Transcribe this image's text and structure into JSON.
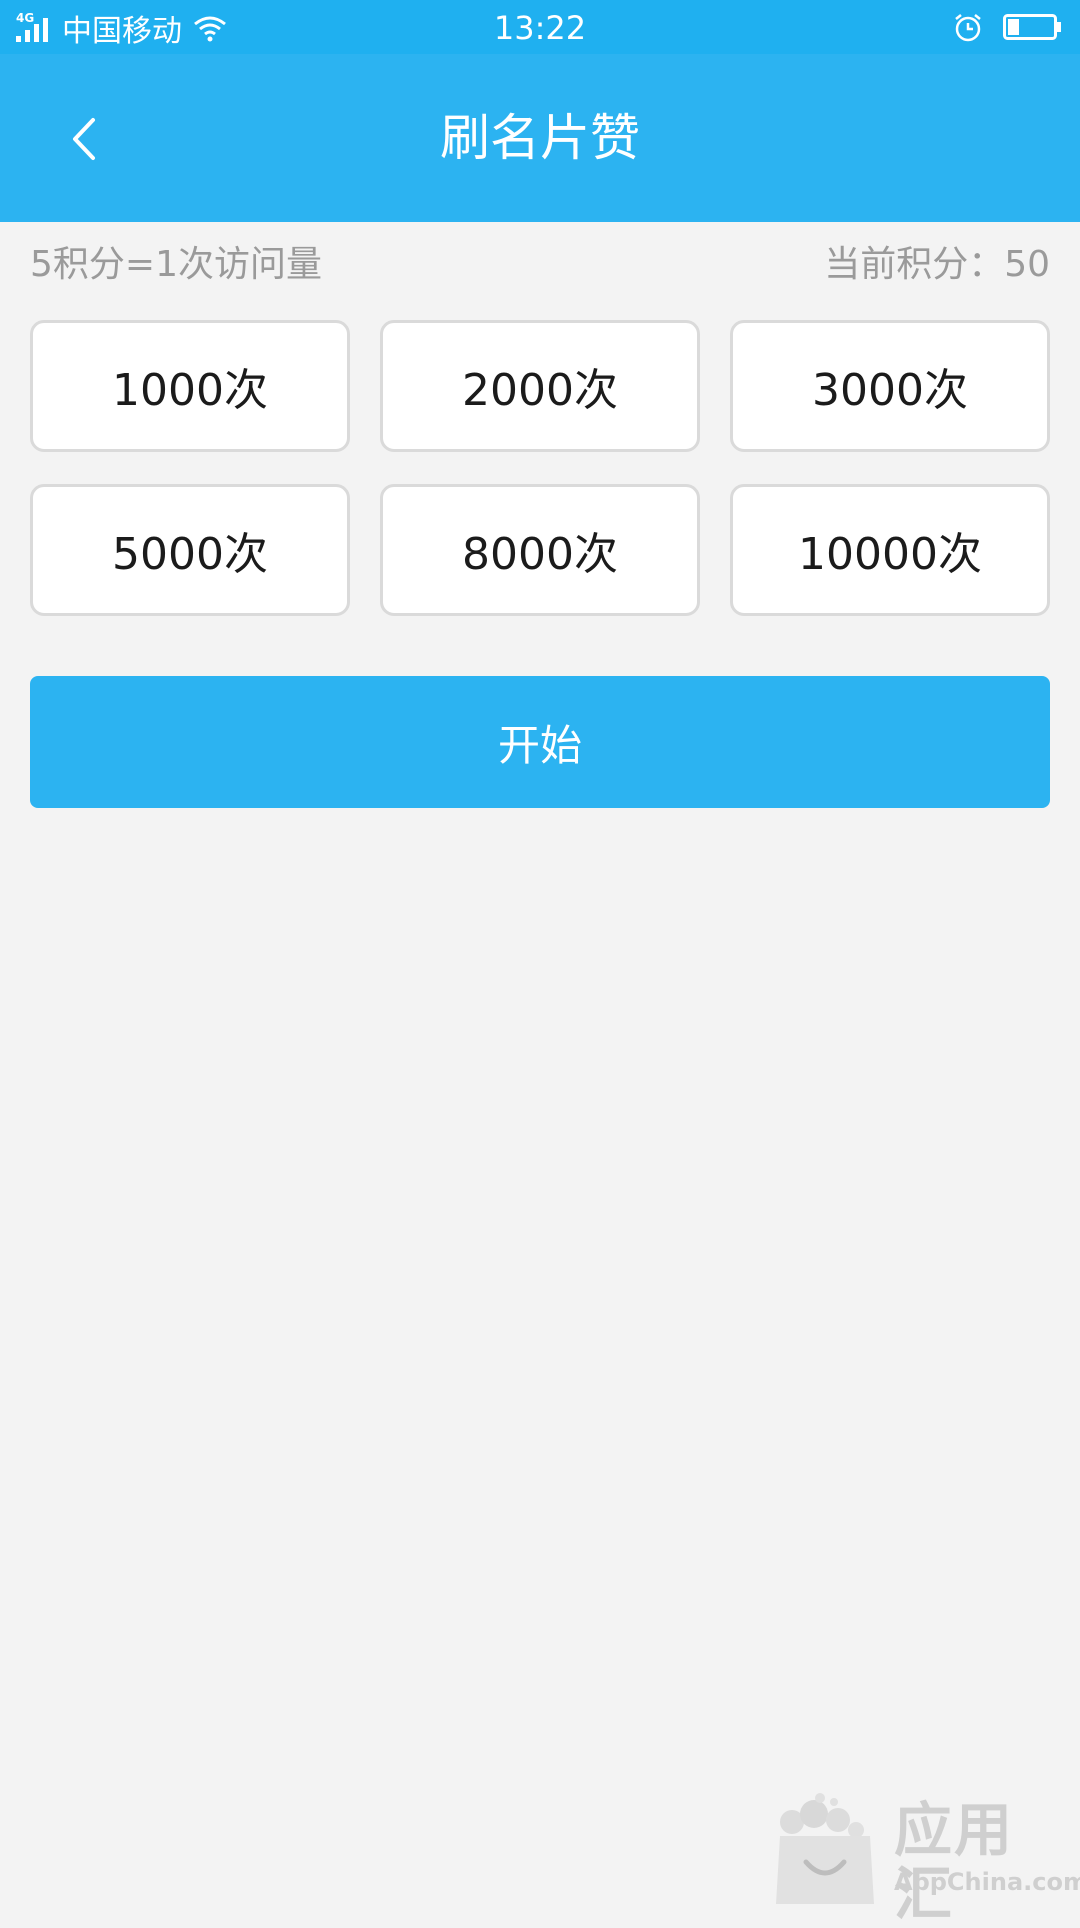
{
  "status_bar": {
    "network": "4G",
    "carrier": "中国移动",
    "time": "13:22",
    "icons": [
      "signal-icon",
      "wifi-icon",
      "alarm-icon",
      "battery-icon"
    ],
    "battery_level": 0.25
  },
  "header": {
    "title": "刷名片赞",
    "back_icon": "back-arrow-icon"
  },
  "info": {
    "rate": "5积分=1次访问量",
    "points": "当前积分：50"
  },
  "options": [
    {
      "label": "1000次"
    },
    {
      "label": "2000次"
    },
    {
      "label": "3000次"
    },
    {
      "label": "5000次"
    },
    {
      "label": "8000次"
    },
    {
      "label": "10000次"
    }
  ],
  "start_label": "开始",
  "watermark": {
    "name": "应用汇",
    "domain": "AppChina.com"
  },
  "colors": {
    "status_bar": "#1fb0f0",
    "primary": "#2cb3f1",
    "background": "#f3f3f3",
    "muted_text": "#9a9a9a",
    "option_border": "#dadada"
  }
}
